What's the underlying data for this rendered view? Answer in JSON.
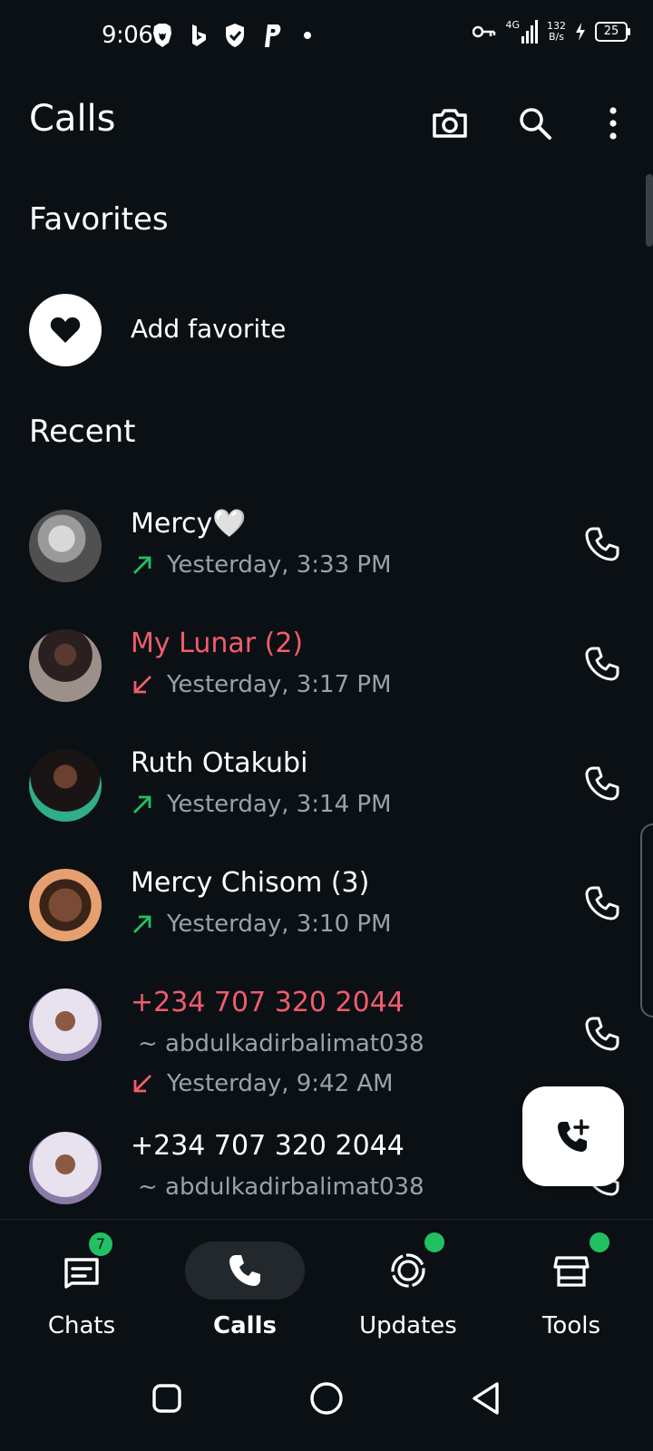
{
  "status_bar": {
    "time": "9:06",
    "network_label": "4G",
    "speed_value": "132",
    "speed_unit": "B/s",
    "battery": "25"
  },
  "header": {
    "title": "Calls"
  },
  "favorites": {
    "heading": "Favorites",
    "add_label": "Add favorite"
  },
  "recent": {
    "heading": "Recent",
    "items": [
      {
        "name": "Mercy🤍",
        "sub": "",
        "time": "Yesterday, 3:33 PM",
        "direction": "outgoing",
        "missed": false
      },
      {
        "name": "My Lunar (2)",
        "sub": "",
        "time": "Yesterday, 3:17 PM",
        "direction": "missed",
        "missed": true
      },
      {
        "name": "Ruth Otakubi",
        "sub": "",
        "time": "Yesterday, 3:14 PM",
        "direction": "outgoing",
        "missed": false
      },
      {
        "name": "Mercy Chisom (3)",
        "sub": "",
        "time": "Yesterday, 3:10 PM",
        "direction": "outgoing",
        "missed": false
      },
      {
        "name": "+234 707 320 2044",
        "sub": "~ abdulkadirbalimat038",
        "time": "Yesterday, 9:42 AM",
        "direction": "missed",
        "missed": true
      },
      {
        "name": "+234 707 320 2044",
        "sub": "~ abdulkadirbalimat038",
        "time": "",
        "direction": "outgoing",
        "missed": false
      }
    ]
  },
  "bottom_nav": {
    "chats": "Chats",
    "chats_badge": "7",
    "calls": "Calls",
    "updates": "Updates",
    "tools": "Tools"
  },
  "colors": {
    "background": "#0b1014",
    "accent_green": "#21c063",
    "missed_red": "#f15c6d",
    "secondary_text": "#9aa2a8"
  }
}
